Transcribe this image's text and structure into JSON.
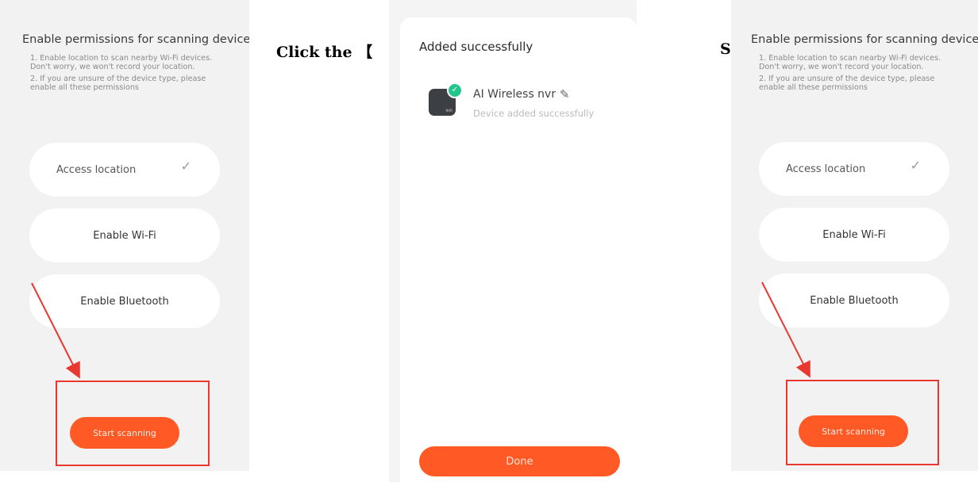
{
  "permissions_screen": {
    "title": "Enable permissions for scanning devices",
    "note_1": "1. Enable location to scan nearby Wi-Fi devices. Don't worry, we won't record your location.",
    "note_2": "2. If you are unsure of the device type, please enable all these permissions",
    "access_location": "Access location",
    "check_glyph": "✓",
    "enable_wifi": "Enable Wi-Fi",
    "enable_bluetooth": "Enable Bluetooth",
    "start_scanning": "Start scanning"
  },
  "instruction_left": "Click the 【",
  "instruction_right": "S",
  "added_screen": {
    "title": "Added successfully",
    "device_name": "AI Wireless nvr",
    "device_status": "Device added successfully",
    "device_label": "NVR",
    "done": "Done"
  },
  "icons": [
    "check-icon",
    "pencil-icon",
    "success-badge-icon",
    "device-icon",
    "arrow-icon"
  ],
  "colors": {
    "accent": "#ff5a26",
    "highlight_box": "#e8382f",
    "success": "#22c58b"
  }
}
